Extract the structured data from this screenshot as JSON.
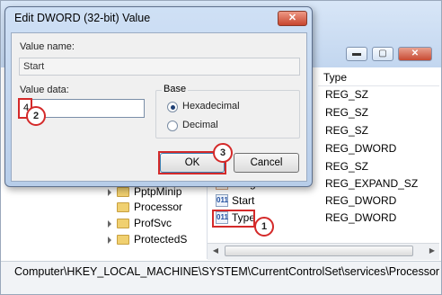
{
  "dialog": {
    "title": "Edit DWORD (32-bit) Value",
    "close_glyph": "✕",
    "value_name_label": "Value name:",
    "value_name": "Start",
    "value_data_label": "Value data:",
    "value_data": "4",
    "base_label": "Base",
    "radio_hex": "Hexadecimal",
    "radio_dec": "Decimal",
    "selected_base": "Hexadecimal",
    "ok": "OK",
    "cancel": "Cancel"
  },
  "list": {
    "col_type": "Type",
    "rows": [
      {
        "name": "",
        "type": "REG_SZ"
      },
      {
        "name": "",
        "type": "REG_SZ"
      },
      {
        "name": "",
        "type": "REG_SZ"
      },
      {
        "name": "",
        "type": "REG_DWORD"
      },
      {
        "name": "",
        "type": "REG_SZ"
      },
      {
        "name": "ImagePath",
        "type": "REG_EXPAND_SZ",
        "icon": "ab"
      },
      {
        "name": "Start",
        "type": "REG_DWORD",
        "icon": "011"
      },
      {
        "name": "Type",
        "type": "REG_DWORD",
        "icon": "011"
      }
    ]
  },
  "tree": {
    "items": [
      "PptpMinip",
      "Processor",
      "ProfSvc",
      "ProtectedS"
    ]
  },
  "status_path": "Computer\\HKEY_LOCAL_MACHINE\\SYSTEM\\CurrentControlSet\\services\\Processor",
  "callouts": [
    "1",
    "2",
    "3"
  ],
  "window_buttons": {
    "minimize": "▬",
    "maximize": "▢",
    "close": "✕"
  },
  "scroll": {
    "left": "◀",
    "right": "▶"
  },
  "colors": {
    "callout": "#d42a2a",
    "dialog_frame": "#b7cde9"
  }
}
